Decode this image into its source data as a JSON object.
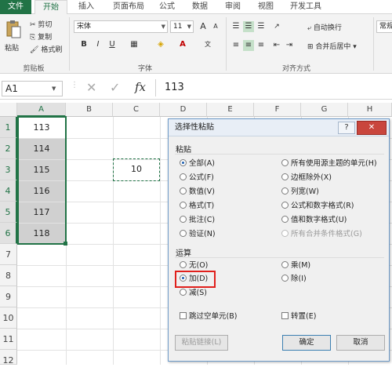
{
  "tabs": {
    "file": "文件",
    "home": "开始",
    "insert": "插入",
    "page_layout": "页面布局",
    "formulas": "公式",
    "data": "数据",
    "review": "审阅",
    "view": "视图",
    "developer": "开发工具"
  },
  "ribbon": {
    "clipboard": {
      "paste": "粘贴",
      "cut": "剪切",
      "copy": "复制",
      "format_painter": "格式刷",
      "group_label": "剪贴板"
    },
    "font": {
      "name": "宋体",
      "size": "11",
      "group_label": "字体",
      "bold": "B",
      "italic": "I",
      "underline": "U",
      "grow": "A",
      "shrink": "A"
    },
    "alignment": {
      "wrap_text": "自动换行",
      "merge_center": "合并后居中",
      "group_label": "对齐方式"
    },
    "number": {
      "format": "常规"
    }
  },
  "formula_bar": {
    "name_box": "A1",
    "cancel": "✕",
    "enter": "✓",
    "fx": "fx",
    "value": "113"
  },
  "grid": {
    "columns": [
      "A",
      "B",
      "C",
      "D",
      "E",
      "F",
      "G",
      "H"
    ],
    "rows": [
      "1",
      "2",
      "3",
      "4",
      "5",
      "6",
      "7",
      "8",
      "9",
      "10",
      "11",
      "12"
    ],
    "column_a": [
      "113",
      "114",
      "115",
      "116",
      "117",
      "118"
    ],
    "c3": "10"
  },
  "dialog": {
    "title": "选择性粘贴",
    "help": "?",
    "close": "✕",
    "paste_section": "粘贴",
    "paste_options": [
      "全部(A)",
      "公式(F)",
      "数值(V)",
      "格式(T)",
      "批注(C)",
      "验证(N)"
    ],
    "paste_options_right": [
      "所有使用源主题的单元(H)",
      "边框除外(X)",
      "列宽(W)",
      "公式和数字格式(R)",
      "值和数字格式(U)",
      "所有合并条件格式(G)"
    ],
    "operation_section": "运算",
    "operation_left": [
      "无(O)",
      "加(D)",
      "减(S)"
    ],
    "operation_right": [
      "乘(M)",
      "除(I)"
    ],
    "skip_blanks": "跳过空单元(B)",
    "transpose": "转置(E)",
    "paste_link": "粘贴链接(L)",
    "ok": "确定",
    "cancel": "取消"
  },
  "colors": {
    "excel_green": "#217346",
    "highlight_red": "#e0201c"
  }
}
